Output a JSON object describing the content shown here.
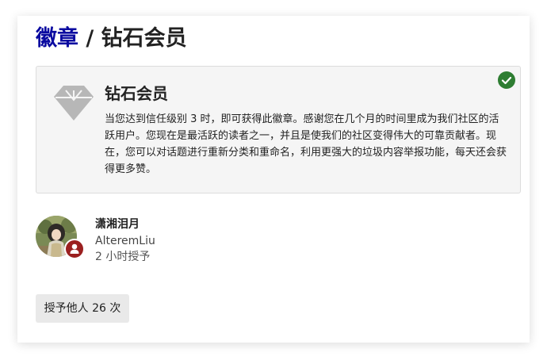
{
  "breadcrumb": {
    "link_label": "徽章",
    "separator": " / ",
    "current": "钻石会员"
  },
  "badge": {
    "name": "钻石会员",
    "description": "当您达到信任级别 3 时，即可获得此徽章。感谢您在几个月的时间里成为我们社区的活跃用户。您现在是最活跃的读者之一，并且是使我们的社区变得伟大的可靠贡献者。现在，您可以对话题进行重新分类和重命名，利用更强大的垃圾内容举报功能，每天还会获得更多赞。",
    "icon": "diamond-icon",
    "granted_icon": "check-circle-icon",
    "colors": {
      "icon": "#b7b7b7",
      "granted": "#2e7d32",
      "link": "#0a0aa0"
    }
  },
  "recipient": {
    "display_name": "潇湘泪月",
    "username": "AlteremLiu",
    "granted_time": "2 小时授予",
    "avatar_badge_icon": "user-icon",
    "avatar_badge_color": "#9b2020"
  },
  "actions": {
    "grant_label": "授予他人 26 次"
  }
}
